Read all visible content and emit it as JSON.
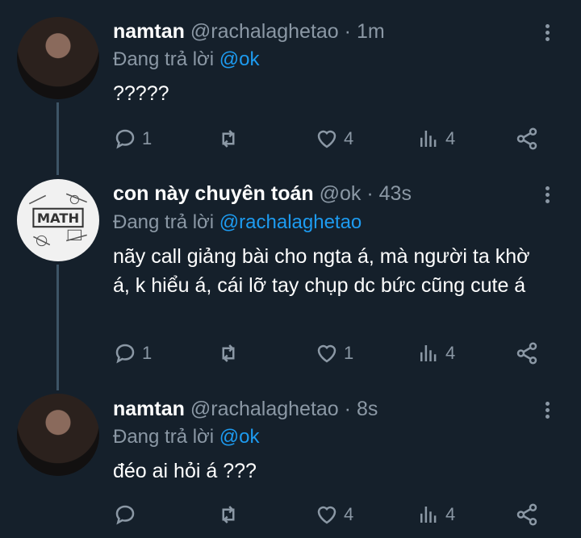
{
  "tweets": [
    {
      "name": "namtan",
      "handle": "@rachalaghetao",
      "time": "1m",
      "replying_prefix": "Đang trả lời",
      "replying_to": "@ok",
      "text": "?????",
      "replies": "1",
      "retweets": "",
      "likes": "4",
      "views": "4"
    },
    {
      "name": "con này chuyên toán",
      "handle": "@ok",
      "time": "43s",
      "replying_prefix": "Đang trả lời",
      "replying_to": "@rachalaghetao",
      "text": "nãy call giảng bài cho ngta á, mà người ta khờ á, k hiểu á, cái lỡ tay chụp dc bức cũng cute á",
      "replies": "1",
      "retweets": "",
      "likes": "1",
      "views": "4"
    },
    {
      "name": "namtan",
      "handle": "@rachalaghetao",
      "time": "8s",
      "replying_prefix": "Đang trả lời",
      "replying_to": "@ok",
      "text": "đéo ai hỏi á ???",
      "replies": "",
      "retweets": "",
      "likes": "4",
      "views": "4"
    }
  ],
  "separator": "·",
  "colors": {
    "background": "#15202b",
    "secondary": "#8b98a5",
    "link": "#1d9bf0"
  },
  "icons": [
    "reply-icon",
    "retweet-icon",
    "like-icon",
    "views-icon",
    "share-icon",
    "more-options-icon"
  ]
}
